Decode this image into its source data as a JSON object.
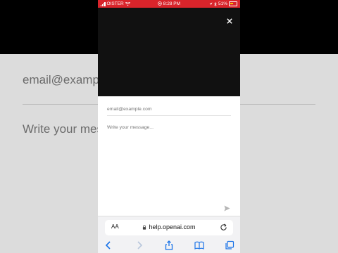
{
  "background_page": {
    "email_placeholder": "email@example.com",
    "message_placeholder": "Write your message..."
  },
  "status_bar": {
    "carrier": "OISTER",
    "time": "8:28 PM",
    "battery_percent": "51%",
    "background_color": "#d9242b"
  },
  "form": {
    "email_placeholder": "email@example.com",
    "message_placeholder": "Write your message..."
  },
  "browser": {
    "text_size_label": "AA",
    "url": "help.openai.com"
  },
  "icons": {
    "close": "close-icon",
    "send": "send-icon",
    "lock": "lock-icon",
    "reload": "reload-icon",
    "back": "chevron-left-icon",
    "forward": "chevron-right-icon",
    "share": "share-icon",
    "bookmarks": "book-icon",
    "tabs": "tabs-icon"
  }
}
